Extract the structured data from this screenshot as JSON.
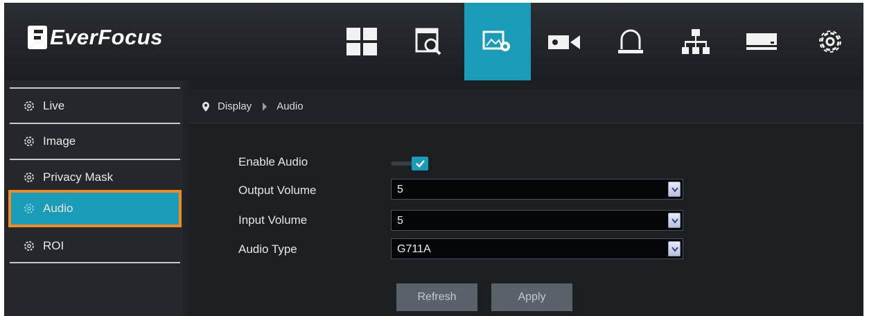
{
  "header": {
    "logo_text": "EverFocus",
    "nav": [
      {
        "icon": "live-grid-icon"
      },
      {
        "icon": "playback-search-icon"
      },
      {
        "icon": "image-settings-icon",
        "active": true
      },
      {
        "icon": "camera-icon"
      },
      {
        "icon": "alarm-bell-icon"
      },
      {
        "icon": "network-icon"
      },
      {
        "icon": "storage-icon"
      },
      {
        "icon": "system-gear-icon"
      }
    ]
  },
  "sidebar": {
    "items": [
      {
        "label": "Live"
      },
      {
        "label": "Image"
      },
      {
        "label": "Privacy Mask"
      },
      {
        "label": "Audio",
        "active": true
      },
      {
        "label": "ROI"
      }
    ]
  },
  "breadcrumb": {
    "parent": "Display",
    "current": "Audio"
  },
  "form": {
    "enable_audio": {
      "label": "Enable Audio",
      "checked": true
    },
    "output_volume": {
      "label": "Output Volume",
      "value": "5"
    },
    "input_volume": {
      "label": "Input Volume",
      "value": "5"
    },
    "audio_type": {
      "label": "Audio Type",
      "value": "G711A"
    }
  },
  "buttons": {
    "refresh": "Refresh",
    "apply": "Apply"
  },
  "colors": {
    "accent": "#1a9cb8",
    "highlight_outline": "#f08a24",
    "background": "#1f2327"
  }
}
